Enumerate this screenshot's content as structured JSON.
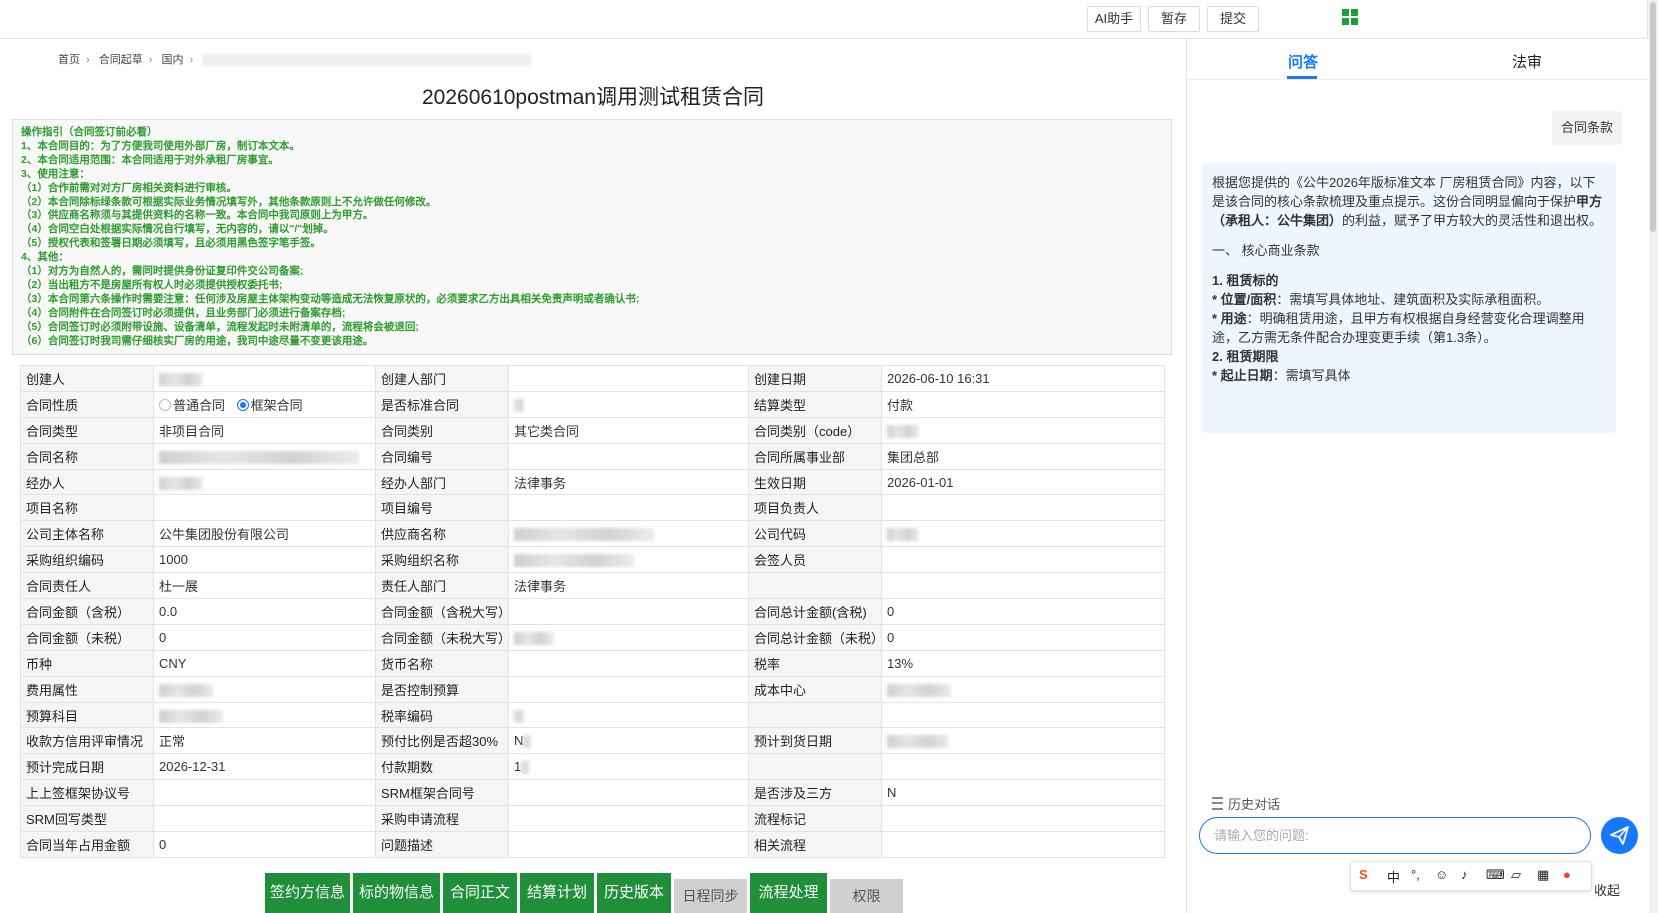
{
  "topbar": {
    "ai_label": "AI助手",
    "save_draft": "暂存",
    "submit": "提交"
  },
  "breadcrumb": [
    "首页",
    "合同起草",
    "国内"
  ],
  "title": "20260610postman调用测试租赁合同",
  "guide": {
    "lines": [
      "操作指引（合同签订前必看）",
      "1、本合同目的：为了方便我司使用外部厂房，制订本文本。",
      "2、本合同适用范围：本合同适用于对外承租厂房事宜。",
      "3、使用注意：",
      "（1）合作前需对对方厂房相关资料进行审核。",
      "（2）本合同除标绿条款可根据实际业务情况填写外，其他条款原则上不允许做任何修改。",
      "（3）供应商名称须与其提供资料的名称一致。本合同中我司原则上为甲方。",
      "（4）合同空白处根据实际情况自行填写，无内容的，请以\"/\"划掉。",
      "（5）授权代表和签署日期必须填写，且必须用黑色签字笔手签。",
      "4、其他：",
      "（1）对方为自然人的，需同时提供身份证复印件交公司备案;",
      "（2）当出租方不是房屋所有权人时必须提供授权委托书;",
      "（3）本合同第六条操作时需要注意：任何涉及房屋主体架构变动等造成无法恢复原状的，必须要求乙方出具相关免责声明或者确认书;",
      "（4）合同附件在合同签订时必须提供，且业务部门必须进行备案存档;",
      "（5）合同签订时必须附带设施、设备清单，流程发起时未附清单的，流程将会被退回;",
      "（6）合同签订时我司需仔细核实厂房的用途，我司中途尽量不变更该用途。"
    ]
  },
  "form": {
    "l": {
      "creator": "创建人",
      "creator_dept": "创建人部门",
      "create_date": "创建日期",
      "nature": "合同性质",
      "is_std": "是否标准合同",
      "settle_type": "结算类型",
      "ctype": "合同类型",
      "ccat": "合同类别",
      "ccat_code": "合同类别（code）",
      "cname": "合同名称",
      "cno": "合同编号",
      "cdivision": "合同所属事业部",
      "handler": "经办人",
      "handler_dept": "经办人部门",
      "eff_date": "生效日期",
      "proj_name": "项目名称",
      "proj_no": "项目编号",
      "proj_lead": "项目负责人",
      "company": "公司主体名称",
      "supplier": "供应商名称",
      "company_code": "公司代码",
      "purch_code": "采购组织编码",
      "purch_name": "采购组织名称",
      "cosign": "会签人员",
      "resp": "合同责任人",
      "resp_dept": "责任人部门",
      "amt_tax": "合同金额（含税）",
      "amt_tax_cap": "合同金额（含税大写）",
      "total_tax": "合同总计金额(含税)",
      "amt_notax": "合同金额（未税）",
      "amt_notax_cap": "合同金额（未税大写）",
      "total_notax": "合同总计金额（未税）",
      "currency": "币种",
      "currency_name": "货币名称",
      "tax_rate": "税率",
      "fee_attr": "费用属性",
      "budget_ctrl": "是否控制预算",
      "cost_center": "成本中心",
      "budget_item": "预算科目",
      "tax_code": "税率编码",
      "credit": "收款方信用评审情况",
      "prepay": "预付比例是否超30%",
      "arrival": "预计到货日期",
      "finish": "预计完成日期",
      "periods": "付款期数",
      "parent": "上上签框架协议号",
      "srm_frame": "SRM框架合同号",
      "third": "是否涉及三方",
      "srm_type": "SRM回写类型",
      "purch_flow": "采购申请流程",
      "flow_tag": "流程标记",
      "year_amt": "合同当年占用金额",
      "issue": "问题描述",
      "related": "相关流程"
    },
    "v": {
      "create_date": "2026-06-10 16:31",
      "nature_opt1": "普通合同",
      "nature_opt2": "框架合同",
      "settle_type": "付款",
      "ctype": "非项目合同",
      "ccat": "其它类合同",
      "cdivision": "集团总部",
      "handler_dept": "法律事务",
      "eff_date": "2026-01-01",
      "company": "公牛集团股份有限公司",
      "purch_code": "1000",
      "resp": "杜一展",
      "resp_dept": "法律事务",
      "amt_tax": "0.0",
      "total_tax": "0",
      "amt_notax": "0",
      "total_notax": "0",
      "currency": "CNY",
      "tax_rate": "13%",
      "credit": "正常",
      "prepay_prefix": "N",
      "finish": "2026-12-31",
      "periods_prefix": "1",
      "third": "N",
      "year_amt": "0"
    }
  },
  "bottom": {
    "b1": "签约方信息",
    "b2": "标的物信息",
    "b3": "合同正文",
    "b4": "结算计划",
    "b5": "历史版本",
    "b6": "日程同步",
    "b7": "流程处理",
    "b8": "权限"
  },
  "panel": {
    "tab_qa": "问答",
    "tab_legal": "法审",
    "tag": "合同条款",
    "a1": "根据您提供的《公牛2026年版标准文本 厂房租赁合同》内容，以下是该合同的核心条款梳理及重点提示。这份合同明显偏向于保护",
    "a1b": "甲方（承租人：公牛集团）",
    "a1c": "的利益，赋予了甲方较大的灵活性和退出权。",
    "a2": "一、 核心商业条款",
    "a3": "1. 租赁标的",
    "a4k": "* 位置/面积",
    "a4": "：需填写具体地址、建筑面积及实际承租面积。",
    "a5k": "* 用途",
    "a5": "：明确租赁用途，且甲方有权根据自身经营变化合理调整用途，乙方需无条件配合办理变更手续（第1.3条）。",
    "a6": "2. 租赁期限",
    "a7k": "* 起止日期",
    "a7": "：需填写具体",
    "history": "历史对话",
    "placeholder": "请输入您的问题:"
  },
  "ime": {
    "lang": "中",
    "collapse": "收起"
  }
}
